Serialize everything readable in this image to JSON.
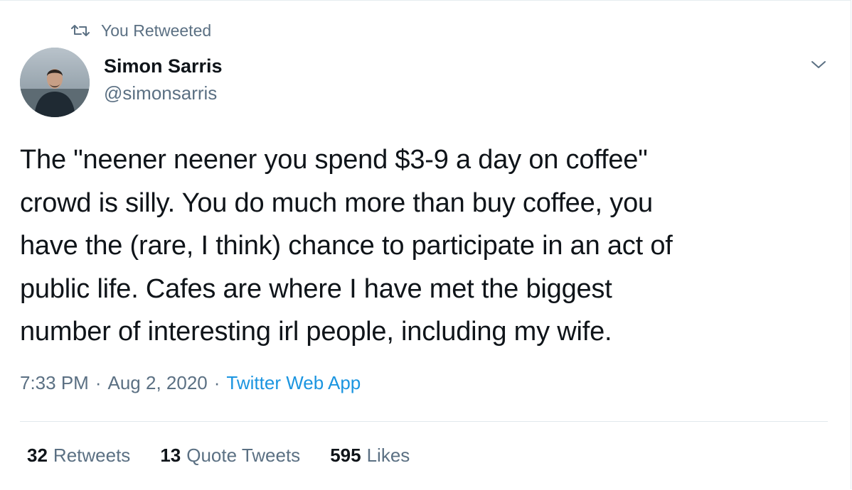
{
  "social_context": {
    "text": "You Retweeted",
    "icon": "retweet-icon"
  },
  "author": {
    "name": "Simon Sarris",
    "handle": "@simonsarris"
  },
  "tweet": {
    "lines": [
      "The \"neener neener you spend $3-9 a day on coffee\"",
      "crowd is silly. You do much more than buy coffee, you",
      "have the (rare, I think) chance to participate in an act of",
      "public life. Cafes are where I have met the biggest",
      "number of interesting irl people, including my wife."
    ]
  },
  "meta": {
    "time": "7:33 PM",
    "separator": "·",
    "date": "Aug 2, 2020",
    "source": "Twitter Web App"
  },
  "stats": {
    "retweets": {
      "count": "32",
      "label": "Retweets"
    },
    "quotes": {
      "count": "13",
      "label": "Quote Tweets"
    },
    "likes": {
      "count": "595",
      "label": "Likes"
    }
  },
  "colors": {
    "text_primary": "#0f1419",
    "text_secondary": "#5b7083",
    "link": "#1b95e0",
    "divider": "#e1e8ed"
  }
}
